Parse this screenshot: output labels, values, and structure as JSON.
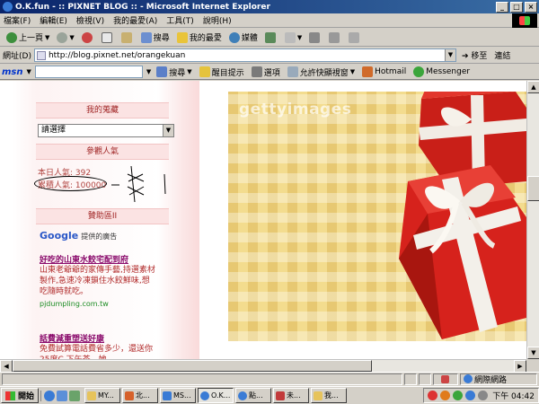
{
  "window": {
    "title": "O.K.fun - :: PIXNET BLOG :: - Microsoft Internet Explorer"
  },
  "menu": [
    "檔案(F)",
    "編輯(E)",
    "檢視(V)",
    "我的最愛(A)",
    "工具(T)",
    "說明(H)"
  ],
  "toolbar": {
    "back": "上一頁",
    "search": "搜尋",
    "favorites": "我的最愛",
    "media": "媒體"
  },
  "address": {
    "label": "網址(D)",
    "url": "http://blog.pixnet.net/orangekuan",
    "go": "移至",
    "links": "連結"
  },
  "msn": {
    "logo": "msn",
    "search": "搜尋",
    "highlight": "醒目提示",
    "options": "選項",
    "popup": "允許快顯視窗",
    "hotmail": "Hotmail",
    "messenger": "Messenger"
  },
  "sidebar": {
    "favorites_header": "我的蒐藏",
    "select_value": "請選擇",
    "visitors_header": "參觀人氣",
    "today_visits": "本日人氣: 392",
    "total_visits": "累積人氣: 100000",
    "sponsor_header": "贊助區II",
    "google_logo": "Google",
    "google_caption": "提供的廣告",
    "ads": [
      {
        "title": "好吃的山東水餃宅配到府",
        "body": "山東老爺爺的家傳手藝,持選素材製作,急速冷凍鎖住水餃鮮味,想吃隨時就吃。",
        "url": "pjdumpling.com.tw"
      },
      {
        "title": "話費減重塑送好康",
        "body": "免費試算電話費省多少，還送你25度C 下午茶，她"
      }
    ]
  },
  "photo": {
    "watermark": "gettyimages"
  },
  "status": {
    "zone": "網際網路"
  },
  "taskbar": {
    "start": "開始",
    "tasks": [
      "MY...",
      "北...",
      "MS...",
      "O.K...",
      "點...",
      "未...",
      "我..."
    ],
    "clock": "下午 04:42"
  },
  "colors": {
    "title_bar": "#0a246a",
    "section_header_bg": "#fbe3e3",
    "section_header_text": "#a02525",
    "ad_title": "#8a0a6b",
    "ad_body": "#b12a2a",
    "ad_url": "#1c8c23",
    "gift_red": "#d6221c",
    "ribbon": "#f3f0ea"
  }
}
